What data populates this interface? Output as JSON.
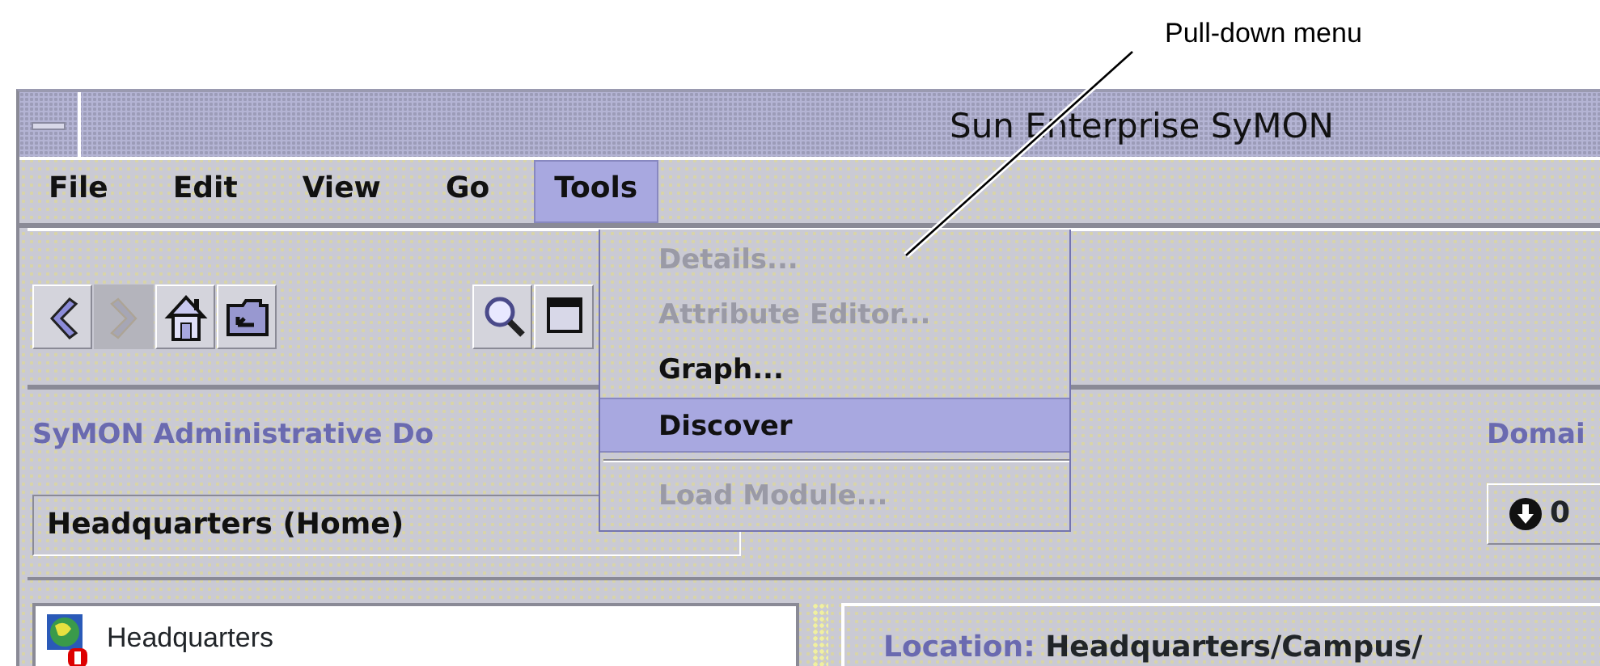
{
  "callout": {
    "label": "Pull-down menu"
  },
  "window": {
    "title": "Sun Enterprise SyMON"
  },
  "menu_bar": [
    {
      "label": "File",
      "selected": false
    },
    {
      "label": "Edit",
      "selected": false
    },
    {
      "label": "View",
      "selected": false
    },
    {
      "label": "Go",
      "selected": false
    },
    {
      "label": "Tools",
      "selected": true
    }
  ],
  "toolbar": [
    {
      "kind": "back",
      "disabled": false
    },
    {
      "kind": "forward",
      "disabled": true
    },
    {
      "kind": "home",
      "disabled": false
    },
    {
      "kind": "folder",
      "disabled": false
    },
    {
      "kind": "search",
      "disabled": false
    },
    {
      "kind": "window",
      "disabled": false
    }
  ],
  "dropdown": [
    {
      "label": "Details...",
      "disabled": true,
      "selected": false,
      "separator_before": false
    },
    {
      "label": "Attribute Editor...",
      "disabled": true,
      "selected": false,
      "separator_before": false
    },
    {
      "label": "Graph...",
      "disabled": false,
      "selected": false,
      "separator_before": false
    },
    {
      "label": "Discover",
      "disabled": false,
      "selected": true,
      "separator_before": false
    },
    {
      "label": "Load Module...",
      "disabled": true,
      "selected": false,
      "separator_before": true
    }
  ],
  "domain_panel": {
    "label": "SyMON Administrative Do",
    "domain": "Headquarters (Home)"
  },
  "right_panel": {
    "label": "Domai",
    "button": "0"
  },
  "tree": [
    {
      "label": "Headquarters"
    }
  ],
  "location": {
    "label": "Location:",
    "value": "Headquarters/Campus/"
  }
}
